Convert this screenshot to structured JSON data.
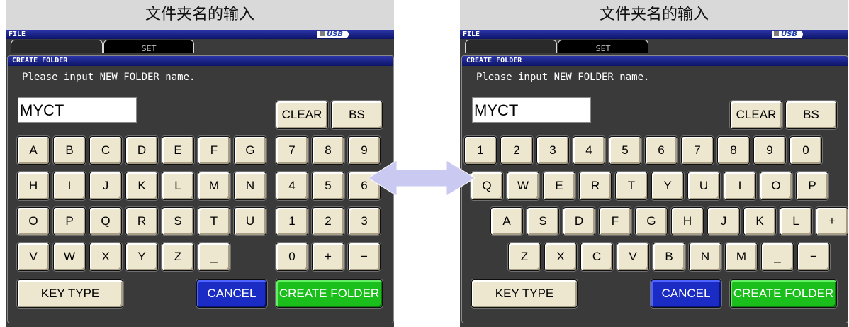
{
  "caption": "文件夹名的输入",
  "screen": {
    "file_bar": "FILE",
    "usb_label": "USB",
    "bg_tab": "SET"
  },
  "dialog": {
    "title": "CREATE FOLDER",
    "prompt": "Please input NEW FOLDER name.",
    "input_value": "MYCT",
    "clear": "CLEAR",
    "bs": "BS",
    "key_type": "KEY TYPE",
    "cancel": "CANCEL",
    "create": "CREATE FOLDER"
  },
  "left_keyboard": {
    "letter_rows": [
      [
        "A",
        "B",
        "C",
        "D",
        "E",
        "F",
        "G"
      ],
      [
        "H",
        "I",
        "J",
        "K",
        "L",
        "M",
        "N"
      ],
      [
        "O",
        "P",
        "Q",
        "R",
        "S",
        "T",
        "U"
      ],
      [
        "V",
        "W",
        "X",
        "Y",
        "Z",
        "_"
      ]
    ],
    "number_rows": [
      [
        "7",
        "8",
        "9"
      ],
      [
        "4",
        "5",
        "6"
      ],
      [
        "1",
        "2",
        "3"
      ],
      [
        "0",
        "+",
        "−"
      ]
    ]
  },
  "right_keyboard": {
    "rows": [
      [
        "1",
        "2",
        "3",
        "4",
        "5",
        "6",
        "7",
        "8",
        "9",
        "0"
      ],
      [
        "Q",
        "W",
        "E",
        "R",
        "T",
        "Y",
        "U",
        "I",
        "O",
        "P"
      ],
      [
        "A",
        "S",
        "D",
        "F",
        "G",
        "H",
        "J",
        "K",
        "L",
        "+"
      ],
      [
        "Z",
        "X",
        "C",
        "V",
        "B",
        "N",
        "M",
        "_",
        "−"
      ]
    ]
  },
  "colors": {
    "key_face": "#eee7d0",
    "cancel_bg": "#1b2cc4",
    "create_bg": "#1bbf1b",
    "title_bar": "#0c1468",
    "arrow": "#c9c9f2"
  },
  "icons": {
    "swap_arrow": "double-headed-arrow-icon",
    "usb_indicator": "usb-status-icon"
  }
}
